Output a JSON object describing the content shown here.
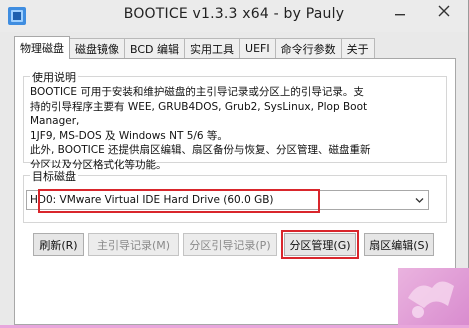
{
  "window": {
    "title": "BOOTICE v1.3.3 x64 - by Pauly"
  },
  "tabs": [
    {
      "label": "物理磁盘"
    },
    {
      "label": "磁盘镜像"
    },
    {
      "label": "BCD 编辑"
    },
    {
      "label": "实用工具"
    },
    {
      "label": "UEFI"
    },
    {
      "label": "命令行参数"
    },
    {
      "label": "关于"
    }
  ],
  "description": {
    "label": "使用说明",
    "lines": [
      "BOOTICE 可用于安装和维护磁盘的主引导记录或分区上的引导记录。支",
      "持的引导程序主要有 WEE, GRUB4DOS, Grub2, SysLinux, Plop Boot Manager,",
      "1JF9, MS-DOS 及 Windows NT 5/6 等。",
      "此外, BOOTICE 还提供扇区编辑、扇区备份与恢复、分区管理、磁盘重新",
      "分区以及分区格式化等功能。"
    ]
  },
  "target_disk": {
    "label": "目标磁盘",
    "selected": "HD0: VMware Virtual IDE Hard Drive (60.0 GB)"
  },
  "buttons": {
    "refresh": "刷新(R)",
    "mbr": "主引导记录(M)",
    "pbr": "分区引导记录(P)",
    "parts_manage": "分区管理(G)",
    "sector_edit": "扇区编辑(S)"
  },
  "colors": {
    "highlight": "#d9262c",
    "accent": "#2a7fd4"
  }
}
